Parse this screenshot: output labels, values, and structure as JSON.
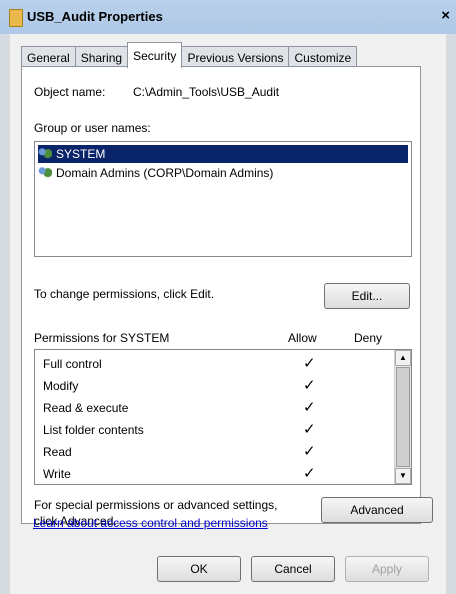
{
  "window": {
    "title": "USB_Audit Properties",
    "close_label": "×"
  },
  "tabs": [
    {
      "label": "General"
    },
    {
      "label": "Sharing"
    },
    {
      "label": "Security",
      "active": true
    },
    {
      "label": "Previous Versions"
    },
    {
      "label": "Customize"
    }
  ],
  "security": {
    "object_name_label": "Object name:",
    "object_name_value": "C:\\Admin_Tools\\USB_Audit",
    "group_label": "Group or user names:",
    "groups": [
      {
        "name": "SYSTEM",
        "selected": true,
        "icon": "users-icon"
      },
      {
        "name": "Domain Admins (CORP\\Domain Admins)",
        "selected": false,
        "icon": "users-icon"
      }
    ],
    "change_text": "To change permissions, click Edit.",
    "edit_label": "Edit...",
    "permissions_label": "Permissions for SYSTEM",
    "allow_header": "Allow",
    "deny_header": "Deny",
    "permissions": [
      {
        "name": "Full control",
        "allow": "✓",
        "deny": ""
      },
      {
        "name": "Modify",
        "allow": "✓",
        "deny": ""
      },
      {
        "name": "Read & execute",
        "allow": "✓",
        "deny": ""
      },
      {
        "name": "List folder contents",
        "allow": "✓",
        "deny": ""
      },
      {
        "name": "Read",
        "allow": "✓",
        "deny": ""
      },
      {
        "name": "Write",
        "allow": "✓",
        "deny": ""
      }
    ],
    "special_text_line1": "For special permissions or advanced settings,",
    "special_text_line2": "click Advanced.",
    "advanced_label": "Advanced",
    "learn_link": "Learn about access control and permissions"
  },
  "footer": {
    "ok_label": "OK",
    "cancel_label": "Cancel",
    "apply_label": "Apply"
  }
}
